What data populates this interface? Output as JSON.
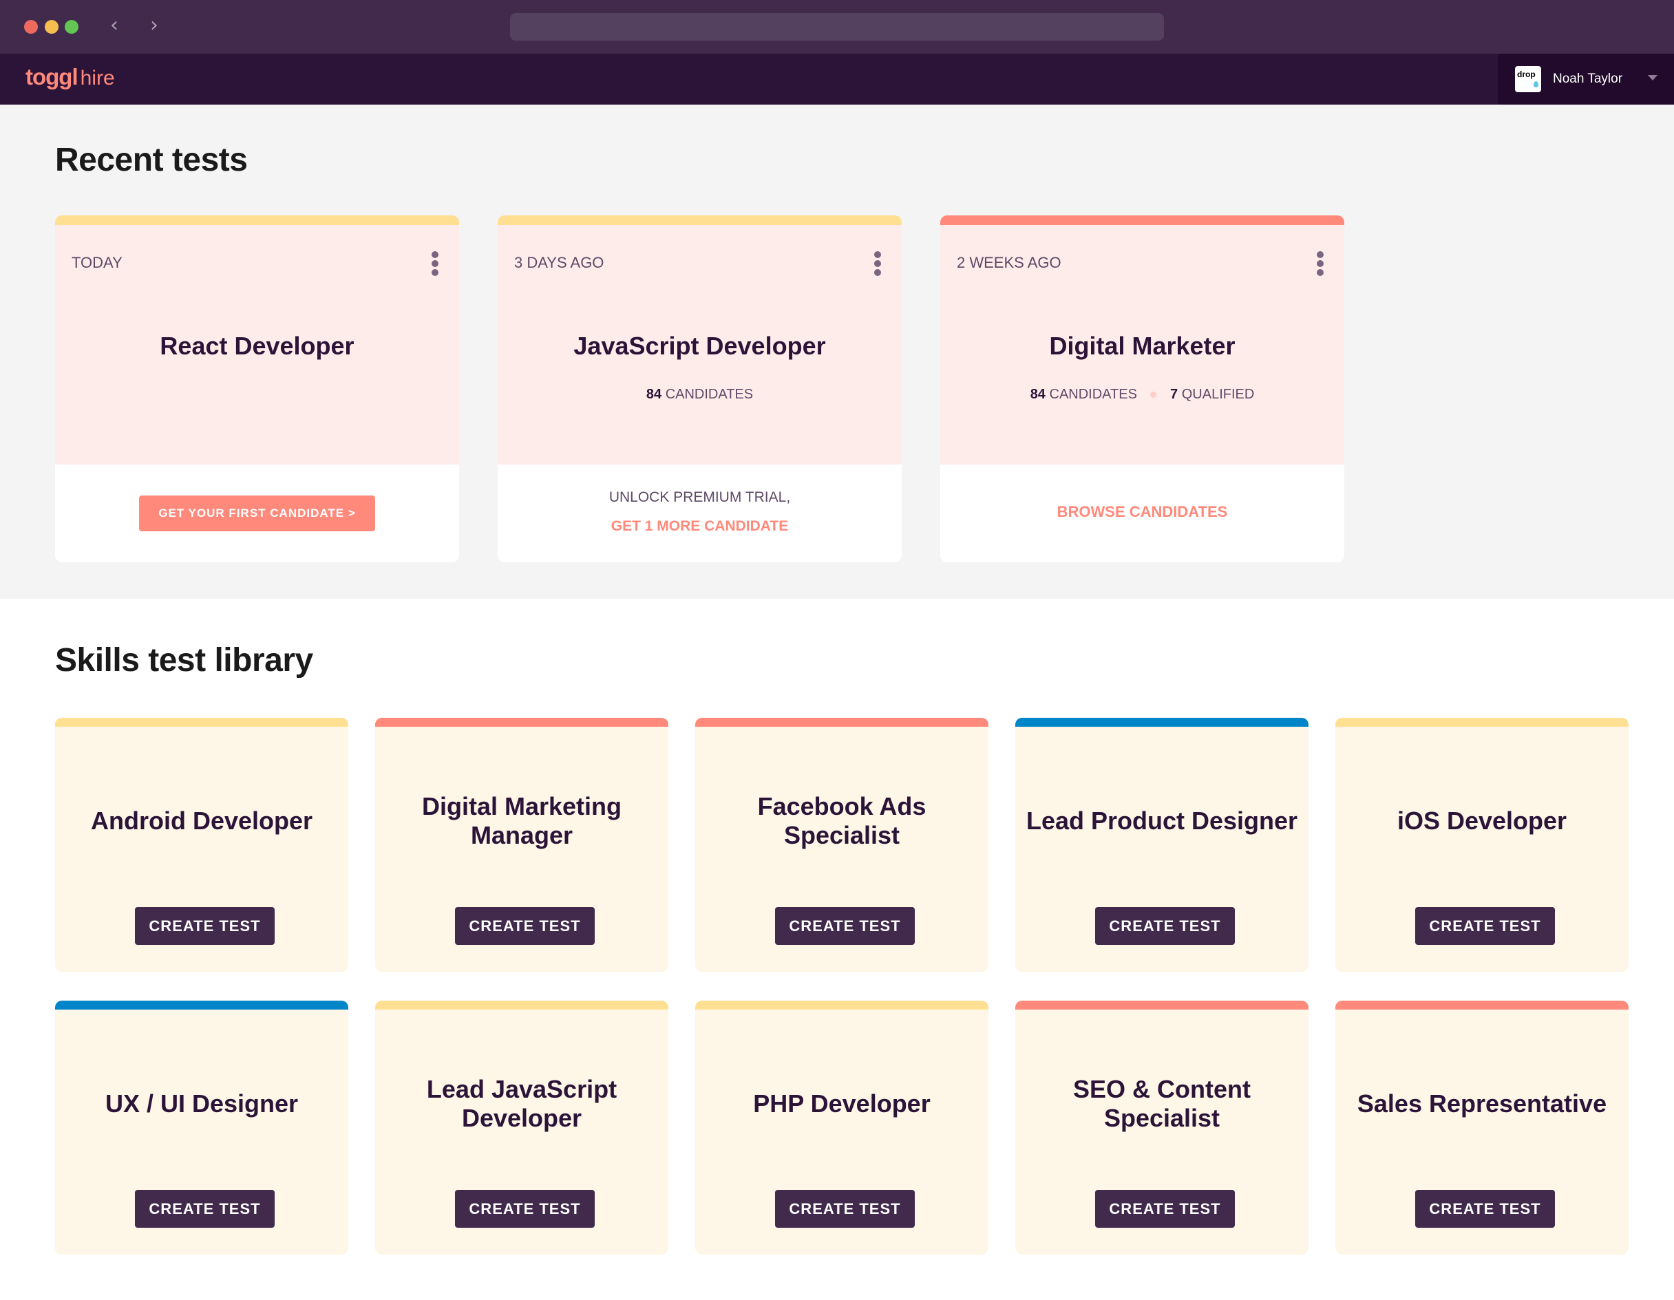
{
  "browser": {
    "back_icon": "‹",
    "forward_icon": "›",
    "url": ""
  },
  "app": {
    "brand": "toggl",
    "product": "hire",
    "user": {
      "avatar_text": "drop",
      "name": "Noah Taylor"
    }
  },
  "colors": {
    "yellow": "#ffdf91",
    "coral": "#ff897a",
    "blue": "#0086c8",
    "dark_purple": "#2c1338",
    "button_purple": "#412a4c"
  },
  "recent": {
    "title": "Recent tests",
    "cards": [
      {
        "date": "TODAY",
        "name": "React Developer",
        "accent": "#ffdf91",
        "cta": "GET YOUR FIRST CANDIDATE >"
      },
      {
        "date": "3 DAYS AGO",
        "name": "JavaScript Developer",
        "accent": "#ffdf91",
        "candidates_count": "84",
        "candidates_label": "CANDIDATES",
        "upsell_text": "UNLOCK PREMIUM TRIAL,",
        "upsell_link": "GET 1 MORE CANDIDATE"
      },
      {
        "date": "2 WEEKS AGO",
        "name": "Digital Marketer",
        "accent": "#ff897a",
        "candidates_count": "84",
        "candidates_label": "CANDIDATES",
        "qualified_count": "7",
        "qualified_label": "QUALIFIED",
        "link": "BROWSE CANDIDATES"
      }
    ]
  },
  "library": {
    "title": "Skills test library",
    "button_label": "CREATE TEST",
    "cards": [
      {
        "title": "Android Developer",
        "accent": "#ffdf91"
      },
      {
        "title": "Digital Marketing Manager",
        "accent": "#ff897a"
      },
      {
        "title": "Facebook Ads Specialist",
        "accent": "#ff897a"
      },
      {
        "title": "Lead Product Designer",
        "accent": "#0086c8"
      },
      {
        "title": "iOS Developer",
        "accent": "#ffdf91"
      },
      {
        "title": "UX / UI Designer",
        "accent": "#0086c8"
      },
      {
        "title": "Lead JavaScript Developer",
        "accent": "#ffdf91"
      },
      {
        "title": "PHP Developer",
        "accent": "#ffdf91"
      },
      {
        "title": "SEO & Content Specialist",
        "accent": "#ff897a"
      },
      {
        "title": "Sales Representative",
        "accent": "#ff897a"
      }
    ]
  }
}
